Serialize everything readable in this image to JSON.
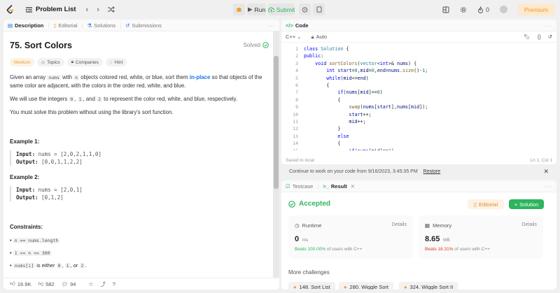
{
  "topbar": {
    "problem_list": "Problem List",
    "run": "Run",
    "submit": "Submit",
    "points": "0",
    "premium": "Premium"
  },
  "description": {
    "tabs": [
      "Description",
      "Editorial",
      "Solutions",
      "Submissions"
    ],
    "title": "75. Sort Colors",
    "status": "Solved",
    "tags": [
      "Medium",
      "Topics",
      "Companies",
      "Hint"
    ],
    "p1_a": "Given an array ",
    "p1_code1": "nums",
    "p1_b": " with ",
    "p1_code2": "n",
    "p1_c": " objects colored red, white, or blue, sort them ",
    "p1_link": "in-place",
    "p1_d": " so that objects of the",
    "p1_line2": "same color are adjacent, with the colors in the order red, white, and blue.",
    "p2_a": "We will use the integers ",
    "p2_c0": "0",
    "p2_c1": "1",
    "p2_and": ", and ",
    "p2_c2": "2",
    "p2_b": " to represent the color red, white, and blue, respectively.",
    "p3": "You must solve this problem without using the library's sort function.",
    "ex1_title": "Example 1:",
    "ex1_input_label": "Input:",
    "ex1_input": " nums = [2,0,2,1,1,0]",
    "ex1_output_label": "Output:",
    "ex1_output": " [0,0,1,1,2,2]",
    "ex2_title": "Example 2:",
    "ex2_input_label": "Input:",
    "ex2_input": " nums = [2,0,1]",
    "ex2_output_label": "Output:",
    "ex2_output": " [0,1,2]",
    "constraints_title": "Constraints:",
    "c1": "n == nums.length",
    "c2": "1 <= n <= 300",
    "c3_code": "nums[i]",
    "c3_text_a": " is either ",
    "c3_text_b": "0",
    "c3_text_c": ", ",
    "c3_text_d": "1",
    "c3_text_e": ", or ",
    "c3_text_f": "2",
    "c3_text_g": ".",
    "likes": "16.9K",
    "dislikes": "582",
    "comments": "94"
  },
  "editor": {
    "tab": "Code",
    "language": "C++",
    "mode": "Auto",
    "line_numbers": [
      "1",
      "2",
      "3",
      "4",
      "5",
      "6",
      "7",
      "8",
      "9",
      "10",
      "11",
      "12",
      "13",
      "14",
      "15"
    ],
    "saved": "Saved to local",
    "cursor": "Ln 1, Col 1",
    "restore_msg": "Continue to work on your code from 9/16/2023, 3:45:35 PM",
    "restore": "Restore"
  },
  "result": {
    "tabs": [
      "Testcase",
      "Result"
    ],
    "status": "Accepted",
    "editorial_btn": "Editorial",
    "solution_btn": "Solution",
    "runtime_label": "Runtime",
    "runtime_value": "0",
    "runtime_unit": "ms",
    "runtime_beats_a": "Beats 100.00%",
    "runtime_beats_b": " of users with C++",
    "memory_label": "Memory",
    "memory_value": "8.65",
    "memory_unit": "MB",
    "memory_beats_a": "Beats 18.31%",
    "memory_beats_b": " of users with C++",
    "details": "Details",
    "more_title": "More challenges",
    "challenges": [
      "148. Sort List",
      "280. Wiggle Sort",
      "324. Wiggle Sort II"
    ]
  },
  "colors": {
    "accent_blue": "#1a73e8",
    "green": "#2db55d",
    "orange": "#f59a23",
    "red": "#e0392b"
  }
}
